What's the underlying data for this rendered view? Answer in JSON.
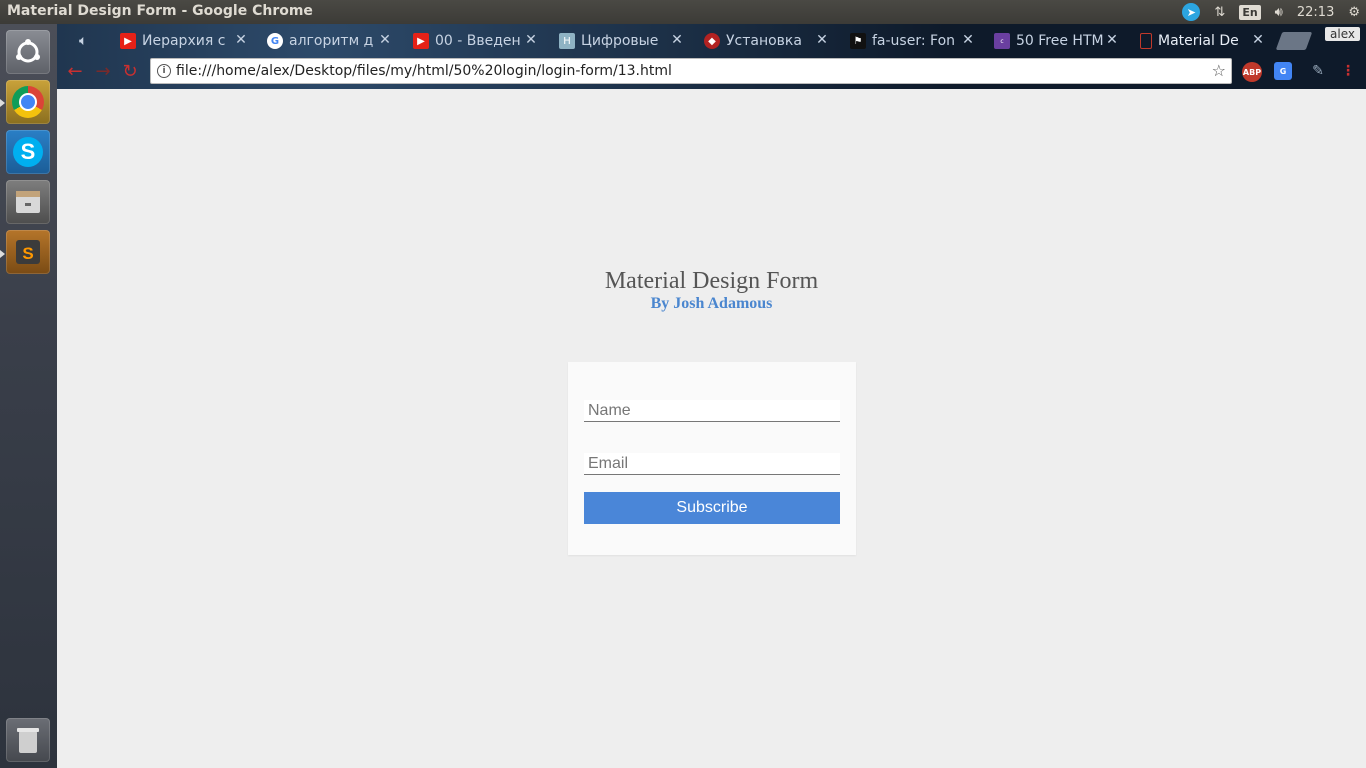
{
  "window": {
    "title": "Material Design Form - Google Chrome"
  },
  "tray": {
    "keyboard": "En",
    "time": "22:13",
    "telegram_icon": "telegram-icon"
  },
  "launcher": {
    "items": [
      {
        "name": "ubuntu-icon"
      },
      {
        "name": "chrome-icon"
      },
      {
        "name": "skype-icon"
      },
      {
        "name": "files-icon"
      },
      {
        "name": "sublime-text-icon",
        "label": "S"
      },
      {
        "name": "trash-icon"
      }
    ]
  },
  "tabs": [
    {
      "label": "Иерархия с",
      "favicon": "youtube"
    },
    {
      "label": "алгоритм д",
      "favicon": "google"
    },
    {
      "label": "00 - Введен",
      "favicon": "youtube"
    },
    {
      "label": "Цифровые",
      "favicon": "hexlet"
    },
    {
      "label": "Установка",
      "favicon": "ruby"
    },
    {
      "label": "fa-user: Fon",
      "favicon": "fontawesome"
    },
    {
      "label": "50 Free HTM",
      "favicon": "colorlib"
    },
    {
      "label": "Material De",
      "favicon": "page",
      "active": true
    }
  ],
  "profile": "alex",
  "address_bar": {
    "url": "file:///home/alex/Desktop/files/my/html/50%20login/login-form/13.html"
  },
  "extensions": [
    "ABP",
    "G"
  ],
  "form": {
    "title": "Material Design Form",
    "author": "By Josh Adamous",
    "name_placeholder": "Name",
    "email_placeholder": "Email",
    "submit_label": "Subscribe"
  },
  "colors": {
    "accent": "#4a86d8",
    "page_bg": "#eeeeee",
    "card_bg": "#fafafa"
  }
}
